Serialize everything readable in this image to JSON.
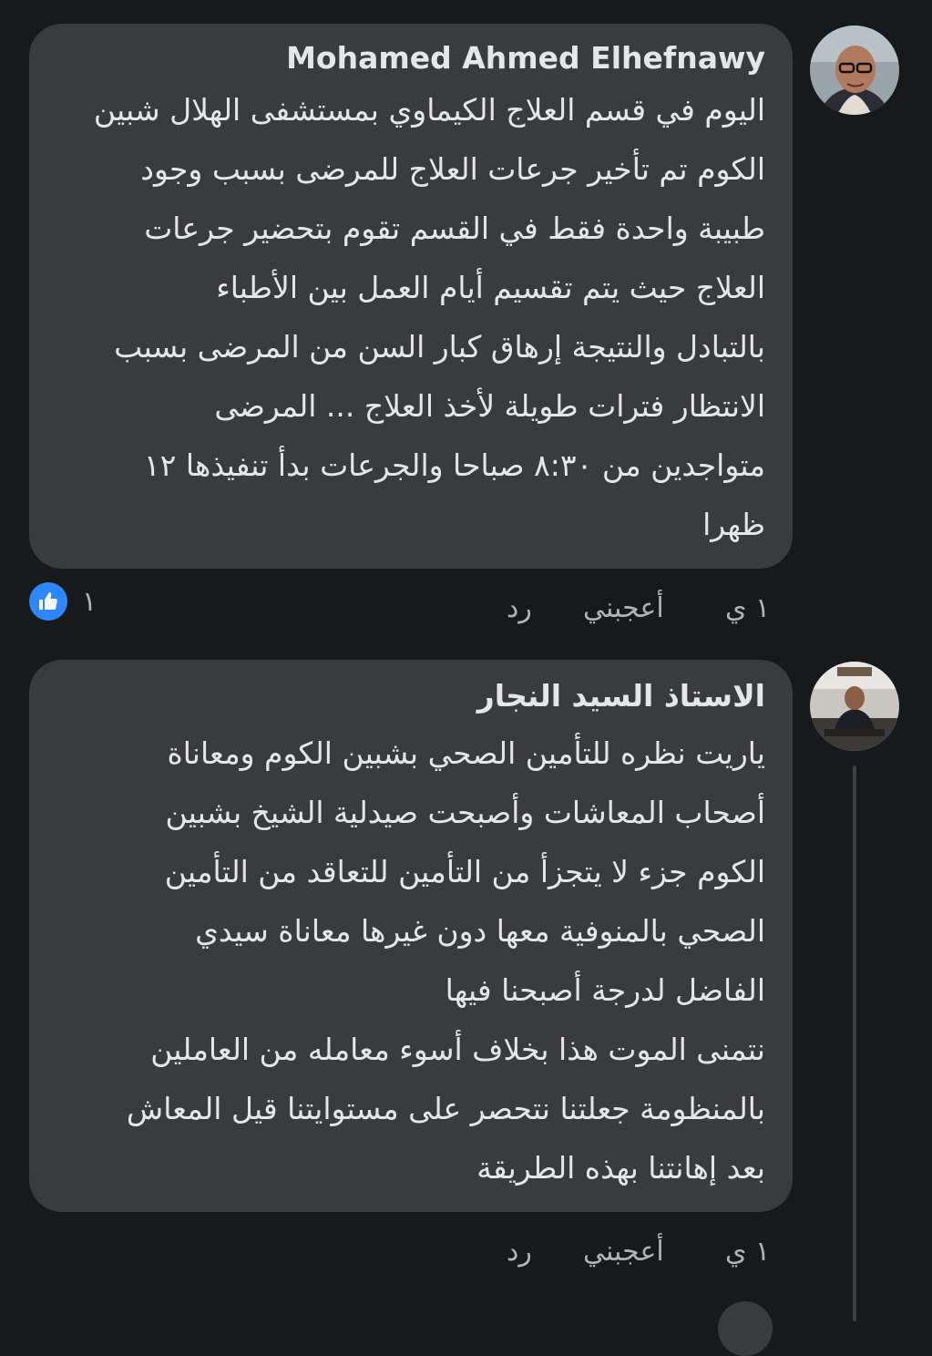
{
  "comments": [
    {
      "author": "Mohamed Ahmed Elhefnawy",
      "lines": [
        "اليوم في قسم العلاج الكيماوي بمستشفى الهلال شبين",
        "الكوم تم تأخير جرعات العلاج للمرضى بسبب وجود",
        "طبيبة واحدة فقط في القسم تقوم بتحضير جرعات",
        "العلاج حيث يتم تقسيم أيام العمل بين الأطباء",
        "بالتبادل والنتيجة إرهاق كبار السن من المرضى بسبب",
        "الانتظار فترات طويلة لأخذ العلاج ... المرضى",
        "متواجدين من ٨:٣٠ صباحا والجرعات بدأ تنفيذها ١٢",
        "ظهرا"
      ],
      "time": "١ ي",
      "like_label": "أعجبني",
      "reply_label": "رد",
      "reaction_count": "١",
      "reaction_icon": "like-icon"
    },
    {
      "author": "الاستاذ السيد النجار",
      "lines": [
        "ياريت نظره للتأمين الصحي بشبين الكوم ومعاناة",
        "أصحاب المعاشات وأصبحت صيدلية الشيخ بشبين",
        "الكوم جزء لا يتجزأ من التأمين للتعاقد من التأمين",
        "الصحي بالمنوفية معها دون غيرها معاناة سيدي",
        "الفاضل لدرجة أصبحنا فيها",
        "نتمنى الموت هذا بخلاف أسوء معامله من العاملين",
        "بالمنظومة جعلتنا نتحصر على مستوايتنا قيل المعاش",
        "بعد إهانتنا بهذه الطريقة"
      ],
      "time": "١ ي",
      "like_label": "أعجبني",
      "reply_label": "رد"
    }
  ],
  "colors": {
    "background": "#18191a",
    "bubble": "#3a3b3c",
    "text": "#e4e6eb",
    "secondary_text": "#b0b3b8",
    "like_blue": "#2d88ff"
  }
}
